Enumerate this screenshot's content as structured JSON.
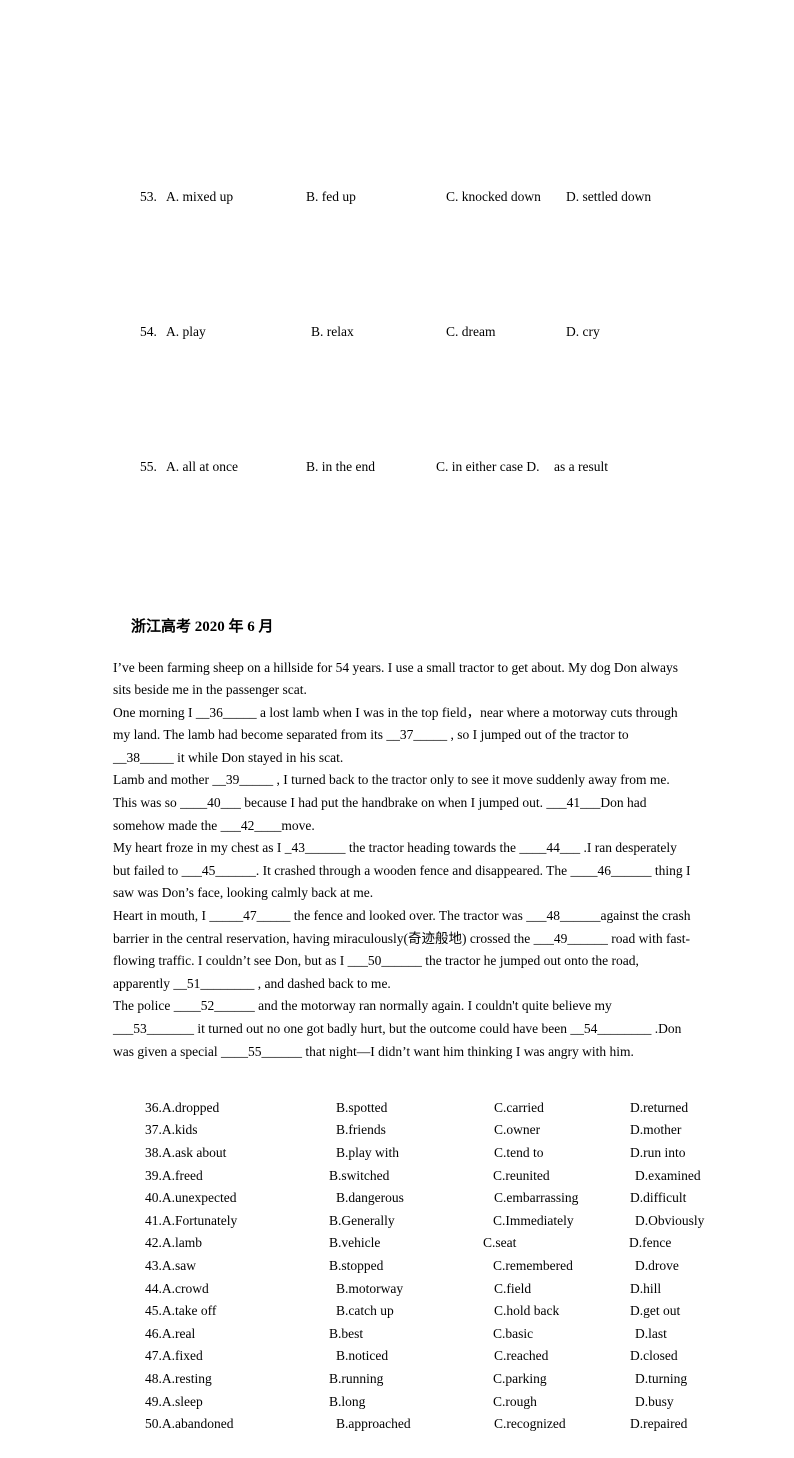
{
  "tail_questions": [
    {
      "number": "53.",
      "a": "A. mixed up",
      "b": "B. fed up",
      "c": "C. knocked down",
      "d": "D. settled down"
    },
    {
      "number": "54.",
      "a": "A. play",
      "b": "B. relax",
      "c": "C. dream",
      "d": "D. cry"
    },
    {
      "number": "55.",
      "a": "A. all at once",
      "b": "B. in the end",
      "c": "C. in either case D.",
      "d": "as a result"
    }
  ],
  "section": {
    "heading": "浙江高考 2020 年 6 月"
  },
  "passage": {
    "paragraphs": [
      "I’ve been farming sheep on a hillside for 54 years. I use a small tractor to get about. My dog Don always sits beside me in the passenger scat.",
      "One morning I __36_____ a lost lamb when I was in the top field，near where a motorway cuts through my land. The lamb had become separated from its __37_____ , so I jumped out of the tractor to __38_____ it while Don stayed in his scat.",
      "Lamb and mother __39_____ , I turned back to the tractor only to see it move suddenly away from me. This was so ____40___ because I had put the handbrake on when I jumped out. ___41___Don had somehow made the ___42____move.",
      "My heart froze in my chest as I _43______ the tractor heading towards the ____44___ .I ran desperately but failed to ___45______. It crashed through a wooden fence and disappeared. The ____46______ thing I saw was Don’s face, looking calmly back at me.",
      "Heart in mouth, I _____47_____ the fence and looked over. The tractor was ___48______against the crash barrier in the central reservation, having miraculously(奇迹般地) crossed the ___49______ road with fast-flowing traffic. I couldn’t see Don, but as I ___50______ the tractor he jumped out onto the road, apparently __51________ , and dashed back to me.",
      "The police ____52______ and the motorway ran normally again. I couldn't quite believe my ___53_______ it turned out no one got badly hurt, but the outcome could have been __54________ .Don was given a special ____55______ that night—I didn’t want him thinking I was angry with him."
    ]
  },
  "options": {
    "rows": [
      {
        "a": "36.A.dropped",
        "b": "B.spotted",
        "c": "C.carried",
        "d": "D.returned"
      },
      {
        "a": "37.A.kids",
        "b": "B.friends",
        "c": "C.owner",
        "d": "D.mother"
      },
      {
        "a": "38.A.ask about",
        "b": "B.play with",
        "c": "C.tend to",
        "d": "D.run into"
      },
      {
        "a": "39.A.freed",
        "b": "B.switched",
        "c": "C.reunited",
        "d": "D.examined"
      },
      {
        "a": "40.A.unexpected",
        "b": "B.dangerous",
        "c": "C.embarrassing",
        "d": "D.difficult"
      },
      {
        "a": "41.A.Fortunately",
        "b": "B.Generally",
        "c": "C.Immediately",
        "d": "D.Obviously"
      },
      {
        "a": "42.A.lamb",
        "b": "B.vehicle",
        "c": "C.seat",
        "d": "D.fence"
      },
      {
        "a": "43.A.saw",
        "b": "B.stopped",
        "c": "C.remembered",
        "d": "D.drove"
      },
      {
        "a": "44.A.crowd",
        "b": "B.motorway",
        "c": "C.field",
        "d": "D.hill"
      },
      {
        "a": "45.A.take off",
        "b": "B.catch up",
        "c": "C.hold back",
        "d": "D.get out"
      },
      {
        "a": "46.A.real",
        "b": "B.best",
        "c": "C.basic",
        "d": "D.last"
      },
      {
        "a": "47.A.fixed",
        "b": "B.noticed",
        "c": "C.reached",
        "d": "D.closed"
      },
      {
        "a": "48.A.resting",
        "b": "B.running",
        "c": "C.parking",
        "d": "D.turning"
      },
      {
        "a": "49.A.sleep",
        "b": "B.long",
        "c": "C.rough",
        "d": "D.busy"
      },
      {
        "a": "50.A.abandoned",
        "b": "B.approached",
        "c": "C.recognized",
        "d": "D.repaired"
      }
    ]
  }
}
